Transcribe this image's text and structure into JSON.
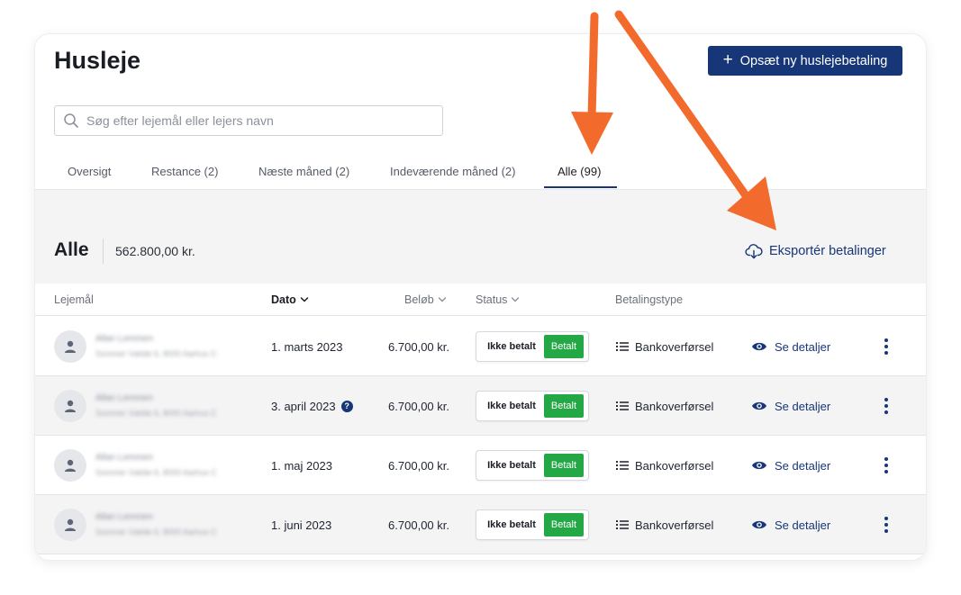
{
  "header": {
    "title": "Husleje",
    "new_button_label": "Opsæt ny huslejebetaling"
  },
  "search": {
    "placeholder": "Søg efter lejemål eller lejers navn",
    "value": ""
  },
  "tabs": [
    {
      "label": "Oversigt",
      "active": false
    },
    {
      "label": "Restance (2)",
      "active": false
    },
    {
      "label": "Næste måned (2)",
      "active": false
    },
    {
      "label": "Indeværende måned (2)",
      "active": false
    },
    {
      "label": "Alle (99)",
      "active": true
    }
  ],
  "section": {
    "title": "Alle",
    "total": "562.800,00 kr.",
    "export_label": "Eksportér betalinger"
  },
  "table": {
    "columns": {
      "lease": "Lejemål",
      "date": "Dato",
      "amount": "Beløb",
      "status": "Status",
      "payment_type": "Betalingstype"
    },
    "status_options": {
      "unpaid": "Ikke betalt",
      "paid": "Betalt"
    },
    "details_label": "Se detaljer",
    "rows": [
      {
        "tenant_name": "Allan Lemmen",
        "tenant_address": "Sommer Vælde 6, 8000 Aarhus C",
        "date": "1. marts 2023",
        "amount": "6.700,00 kr.",
        "payment_type": "Bankoverførsel",
        "status": "paid",
        "help": false
      },
      {
        "tenant_name": "Allan Lemmen",
        "tenant_address": "Sommer Vælde 6, 8000 Aarhus C",
        "date": "3. april 2023",
        "amount": "6.700,00 kr.",
        "payment_type": "Bankoverførsel",
        "status": "paid",
        "help": true
      },
      {
        "tenant_name": "Allan Lemmen",
        "tenant_address": "Sommer Vælde 6, 8000 Aarhus C",
        "date": "1. maj 2023",
        "amount": "6.700,00 kr.",
        "payment_type": "Bankoverførsel",
        "status": "paid",
        "help": false
      },
      {
        "tenant_name": "Allan Lemmen",
        "tenant_address": "Sommer Vælde 6, 8000 Aarhus C",
        "date": "1. juni 2023",
        "amount": "6.700,00 kr.",
        "payment_type": "Bankoverførsel",
        "status": "paid",
        "help": false
      }
    ]
  },
  "colors": {
    "accent": "#163677",
    "paid": "#23a845",
    "annotation_arrow": "#f36b2c"
  }
}
